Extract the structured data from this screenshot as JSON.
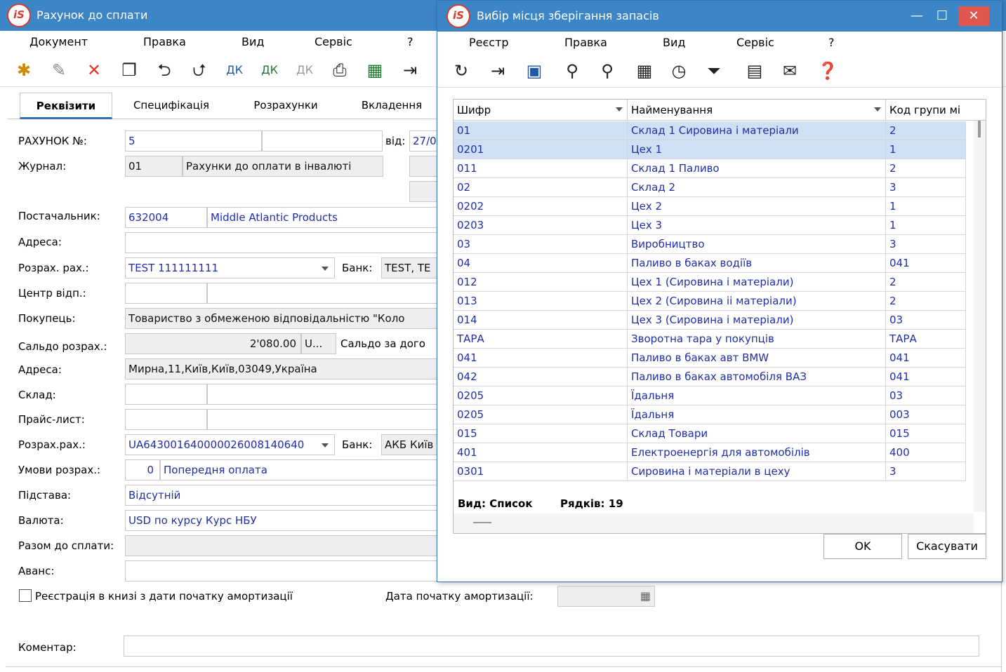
{
  "main": {
    "title": "Рахунок до сплати",
    "menu": [
      "Документ",
      "Правка",
      "Вид",
      "Сервіс",
      "?"
    ],
    "tabs": [
      "Реквізити",
      "Специфікація",
      "Розрахунки",
      "Вкладення"
    ],
    "fields": {
      "invoice_label": "РАХУНОК №:",
      "invoice_no": "5",
      "from_label": "від:",
      "from_date": "27/0",
      "journal_label": "Журнал:",
      "journal_code": "01",
      "journal_name": "Рахунки до оплати в інвалюті",
      "supplier_label": "Постачальник:",
      "supplier_code": "632004",
      "supplier_name": "Middle Atlantic Products",
      "address_label": "Адреса:",
      "account_label": "Розрах. рах.:",
      "account_value": "TEST 111111111",
      "bank_label": "Банк:",
      "bank_value": "TEST, TE",
      "center_label": "Центр відп.:",
      "buyer_label": "Покупець:",
      "buyer_value": "Товариство з обмеженою відповідальністю \"Коло",
      "balance_label": "Сальдо розрах.:",
      "balance_value": "2'080.00",
      "balance_cur": "U...",
      "balance_contract_label": "Сальдо за дого",
      "buyer_address_label": "Адреса:",
      "buyer_address": "Мирна,11,Київ,Київ,03049,Україна",
      "warehouse_label": "Склад:",
      "pricelist_label": "Прайс-лист:",
      "account2_label": "Розрах.рах.:",
      "account2_value": "UA643001640000026008140640",
      "bank2_label": "Банк:",
      "bank2_value": "АКБ Київ",
      "terms_label": "Умови розрах.:",
      "terms_code": "0",
      "terms_value": "Попередня оплата",
      "basis_label": "Підстава:",
      "basis_value": "Відсутній",
      "currency_label": "Валюта:",
      "currency_value": "USD по курсу Курс НБУ",
      "total_label": "Разом до сплати:",
      "advance_label": "Аванс:",
      "register_checkbox": "Реєстрація в книзі з дати початку амортизації",
      "amort_date_label": "Дата початку амортизації:",
      "comment_label": "Коментар:"
    }
  },
  "dialog": {
    "title": "Вибір місця зберігання запасів",
    "menu": [
      "Реєстр",
      "Правка",
      "Вид",
      "Сервіс",
      "?"
    ],
    "columns": [
      "Шифр",
      "Найменування",
      "Код групи мі"
    ],
    "rows": [
      [
        "01",
        "Склад 1 Сировина і матеріали",
        "2"
      ],
      [
        "0201",
        "Цех 1",
        "1"
      ],
      [
        "011",
        "Склад 1 Паливо",
        "2"
      ],
      [
        "02",
        "Склад 2",
        "3"
      ],
      [
        "0202",
        "Цех 2",
        "1"
      ],
      [
        "0203",
        "Цех 3",
        "1"
      ],
      [
        "03",
        "Виробництво",
        "3"
      ],
      [
        "04",
        "Паливо в баках водіїв",
        "041"
      ],
      [
        "012",
        "Цех 1 (Сировина і матеріали)",
        "2"
      ],
      [
        "013",
        "Цех 2 (Сировина ii  матеріали)",
        "2"
      ],
      [
        "014",
        "Цех 3 (Сировина і матеріали)",
        "03"
      ],
      [
        "ТАРА",
        "Зворотна тара у покупців",
        "ТАРА"
      ],
      [
        "041",
        "Паливо в баках авт BMW",
        "041"
      ],
      [
        "042",
        "Паливо в баках автомобіля ВАЗ",
        "041"
      ],
      [
        "0205",
        "Їдальня",
        "03"
      ],
      [
        "0205",
        "Їдальня",
        "003"
      ],
      [
        "015",
        "Склад Товари",
        "015"
      ],
      [
        "401",
        "Електроенергія для автомобілів",
        "400"
      ],
      [
        "0301",
        "Сировина і матеріали в цеху",
        "3"
      ]
    ],
    "status_view": "Вид: Список",
    "status_rows": "Рядків: 19",
    "ok_label": "OK",
    "cancel_label": "Скасувати",
    "selection_color": "#cfe0f4"
  }
}
